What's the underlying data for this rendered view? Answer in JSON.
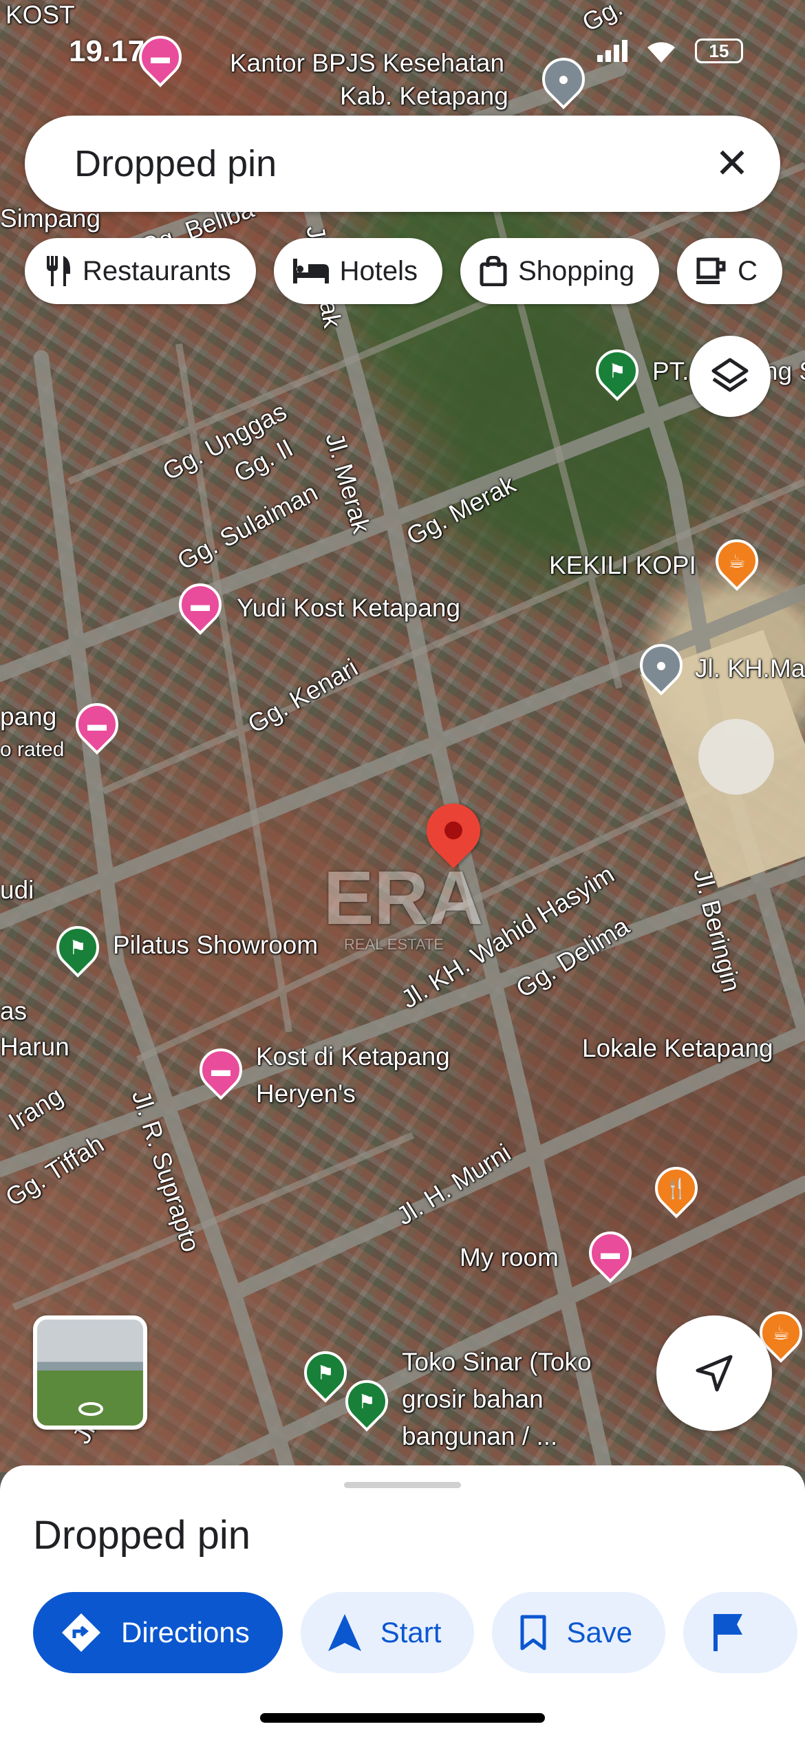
{
  "status_bar": {
    "time": "19.17",
    "battery": "15"
  },
  "search": {
    "query": "Dropped pin"
  },
  "chips": [
    {
      "label": "Restaurants",
      "icon": "fork-knife-icon"
    },
    {
      "label": "Hotels",
      "icon": "bed-icon"
    },
    {
      "label": "Shopping",
      "icon": "shopping-bag-icon"
    },
    {
      "label": "C",
      "icon": "coffee-icon"
    }
  ],
  "map_labels": {
    "kost": "KOST",
    "kantor": "Kantor BPJS Kesehatan",
    "kantor2": "Kab. Ketapang",
    "gg_top": "Gg.",
    "simpang": "Simpang",
    "gg_beliba": "Gg. Beliba",
    "jl_merak_top": "Jl. Merak",
    "pt": "PT.",
    "pt_tail": "ng S",
    "gg_unggas": "Gg. Unggas",
    "gg_ii": "Gg. II",
    "jl_merak": "Jl. Merak",
    "gg_merak": "Gg. Merak",
    "gg_sulaiman": "Gg. Sulaiman",
    "kekili": "KEKILI KOPI",
    "yudi": "Yudi Kost Ketapang",
    "jl_kh_ma": "Jl. KH.Ma",
    "gg_kenari": "Gg. Kenari",
    "pang": "pang",
    "rated": "o rated",
    "udi": "udi",
    "pilatus": "Pilatus Showroom",
    "jl_kh_wahid": "Jl. KH. Wahid Hasyim",
    "gg_delima": "Gg. Delima",
    "jl_beringin": "Jl. Beringin",
    "as": "as",
    "harun": "Harun",
    "kost_heryen1": "Kost di Ketapang",
    "kost_heryen2": "Heryen's",
    "lokale": "Lokale Ketapang",
    "irang": "Irang",
    "gg_tiffah": "Gg. Tiffah",
    "jl_suprapto": "Jl. R. Suprapto",
    "jl_h_murni": "Jl. H. Murni",
    "my_room": "My room",
    "toko1": "Toko Sinar (Toko",
    "toko2": "grosir bahan",
    "toko3": "bangunan / ...",
    "jl_bottom": "Jl. ...1",
    "era": "ERA",
    "era_sub": "REAL ESTATE"
  },
  "sheet": {
    "title": "Dropped pin",
    "actions": [
      {
        "label": "Directions",
        "icon": "directions-icon"
      },
      {
        "label": "Start",
        "icon": "navigation-arrow-icon"
      },
      {
        "label": "Save",
        "icon": "bookmark-icon"
      },
      {
        "label": "",
        "icon": "flag-icon"
      }
    ]
  },
  "colors": {
    "accent": "#0b57d0",
    "pin_red": "#ea4335",
    "hotel_pink": "#e94c9b",
    "place_green": "#188038",
    "food_orange": "#f17f1c"
  }
}
